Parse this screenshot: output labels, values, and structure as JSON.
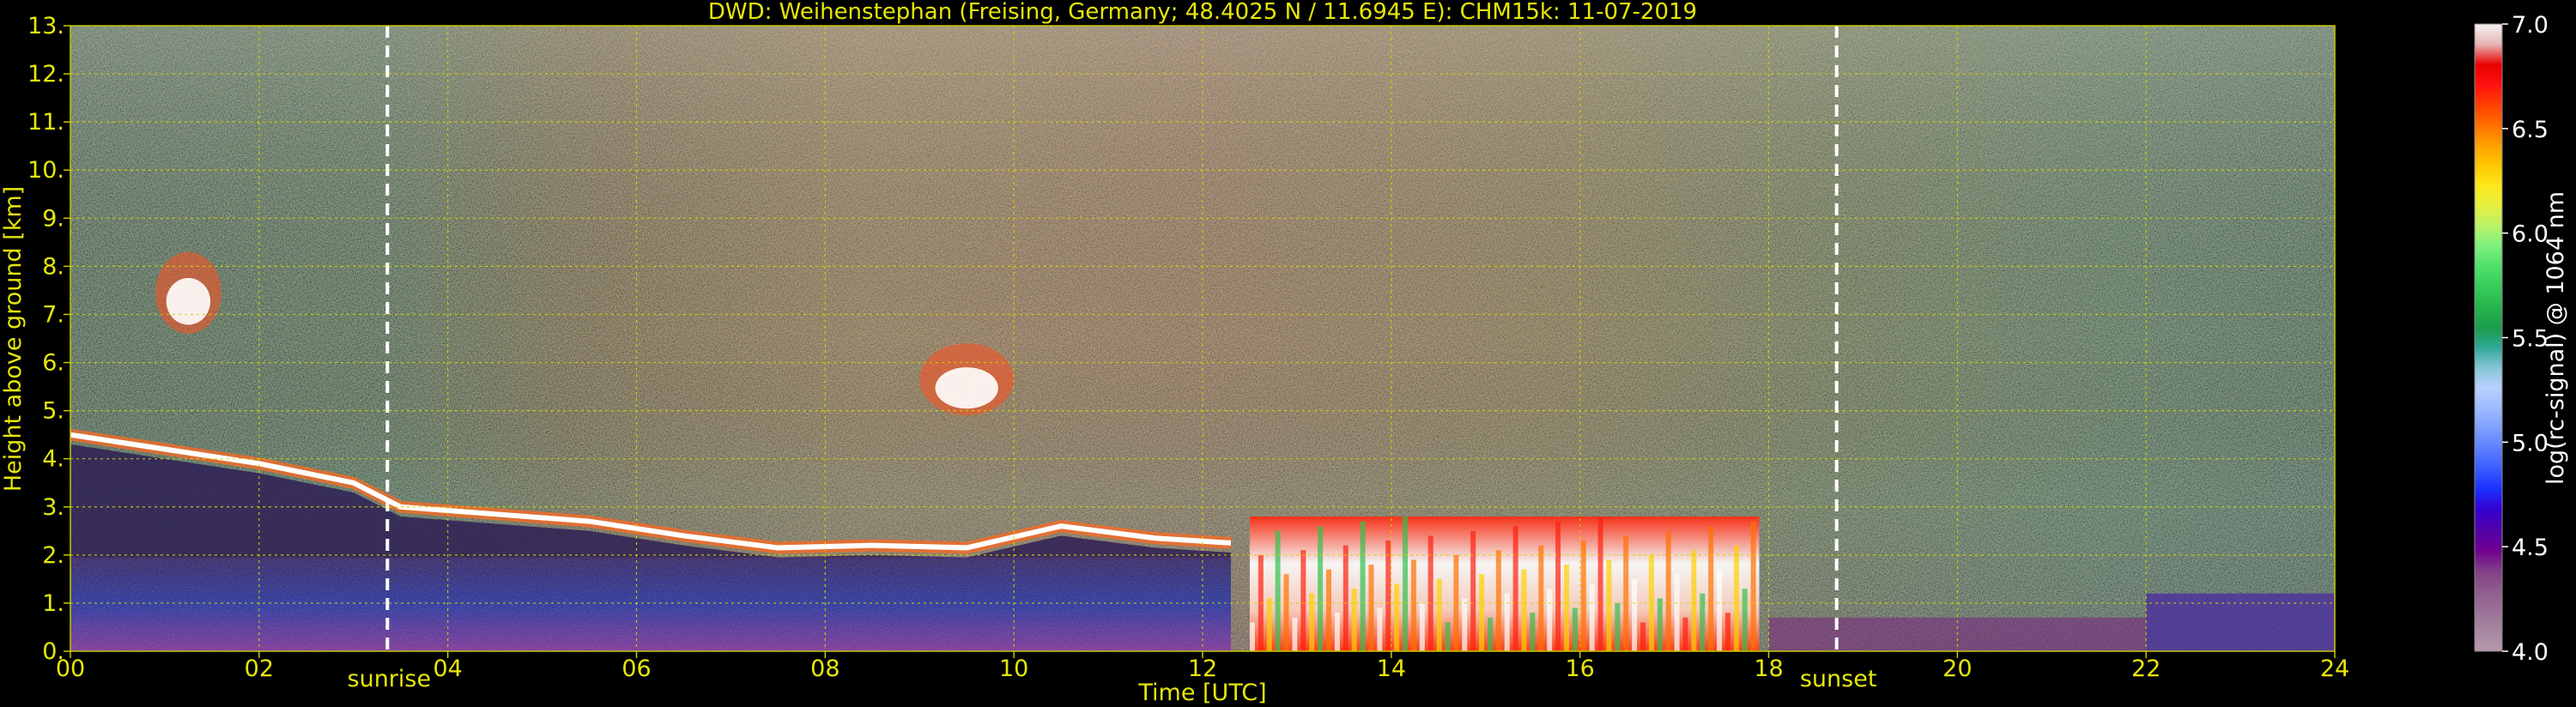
{
  "chart_data": {
    "type": "heatmap",
    "title": "DWD: Weihenstephan (Freising, Germany; 48.4025 N / 11.6945 E):    CHM15k: 11-07-2019",
    "xlabel": "Time [UTC]",
    "ylabel": "Height above ground [km]",
    "xlim": [
      0,
      24
    ],
    "ylim": [
      0,
      13
    ],
    "x_ticks": [
      0,
      2,
      4,
      6,
      8,
      10,
      12,
      14,
      16,
      18,
      20,
      22,
      24
    ],
    "x_tick_labels": [
      "00",
      "02",
      "04",
      "06",
      "08",
      "10",
      "12",
      "14",
      "16",
      "18",
      "20",
      "22",
      "24"
    ],
    "y_ticks": [
      0,
      1,
      2,
      3,
      4,
      5,
      6,
      7,
      8,
      9,
      10,
      11,
      12,
      13
    ],
    "y_tick_labels": [
      "0.",
      "1.",
      "2.",
      "3.",
      "4.",
      "5.",
      "6.",
      "7.",
      "8.",
      "9.",
      "10.",
      "11.",
      "12.",
      "13."
    ],
    "grid": true,
    "grid_color": "#d4d400",
    "annotations": [
      {
        "label": "sunrise",
        "x": 3.36
      },
      {
        "label": "sunset",
        "x": 18.72
      }
    ],
    "colorbar": {
      "label": "log(rc-signal) @ 1064 nm",
      "range": [
        4.0,
        7.0
      ],
      "ticks": [
        4.0,
        4.5,
        5.0,
        5.5,
        6.0,
        6.5,
        7.0
      ],
      "tick_labels": [
        "4.0",
        "4.5",
        "5.0",
        "5.5",
        "6.0",
        "6.5",
        "7.0"
      ],
      "colors": [
        "#b59aac",
        "#a888a2",
        "#9a7196",
        "#8f5c8c",
        "#7f3e86",
        "#700090",
        "#5000a8",
        "#3300d0",
        "#1a30ff",
        "#3a5cff",
        "#5d7fff",
        "#7e9fff",
        "#9dbbff",
        "#b9d0ff",
        "#86c6d6",
        "#30a898",
        "#1a9c4c",
        "#28b44c",
        "#36cc5a",
        "#4ee06a",
        "#7af07c",
        "#b8f26a",
        "#e6f040",
        "#fce81c",
        "#ffc800",
        "#ffa000",
        "#ff7000",
        "#ff4000",
        "#ff1010",
        "#e80000",
        "#e8b4b4",
        "#f4f4f4"
      ]
    },
    "features": {
      "boundary_layer_top_km": [
        [
          0.0,
          4.5
        ],
        [
          1.0,
          4.2
        ],
        [
          2.0,
          3.9
        ],
        [
          3.0,
          3.5
        ],
        [
          3.5,
          3.0
        ],
        [
          4.5,
          2.85
        ],
        [
          5.5,
          2.7
        ],
        [
          6.5,
          2.4
        ],
        [
          7.5,
          2.15
        ],
        [
          8.5,
          2.2
        ],
        [
          9.5,
          2.15
        ],
        [
          10.5,
          2.6
        ],
        [
          11.5,
          2.35
        ],
        [
          12.3,
          2.25
        ]
      ],
      "upper_cloud_patches": [
        {
          "x": [
            9.0,
            10.0
          ],
          "y": [
            4.9,
            6.4
          ]
        },
        {
          "x": [
            0.9,
            1.6
          ],
          "y": [
            6.6,
            8.3
          ]
        }
      ],
      "low_cloud_region": {
        "x": [
          12.5,
          17.9
        ],
        "y": [
          0.0,
          2.8
        ]
      }
    }
  }
}
